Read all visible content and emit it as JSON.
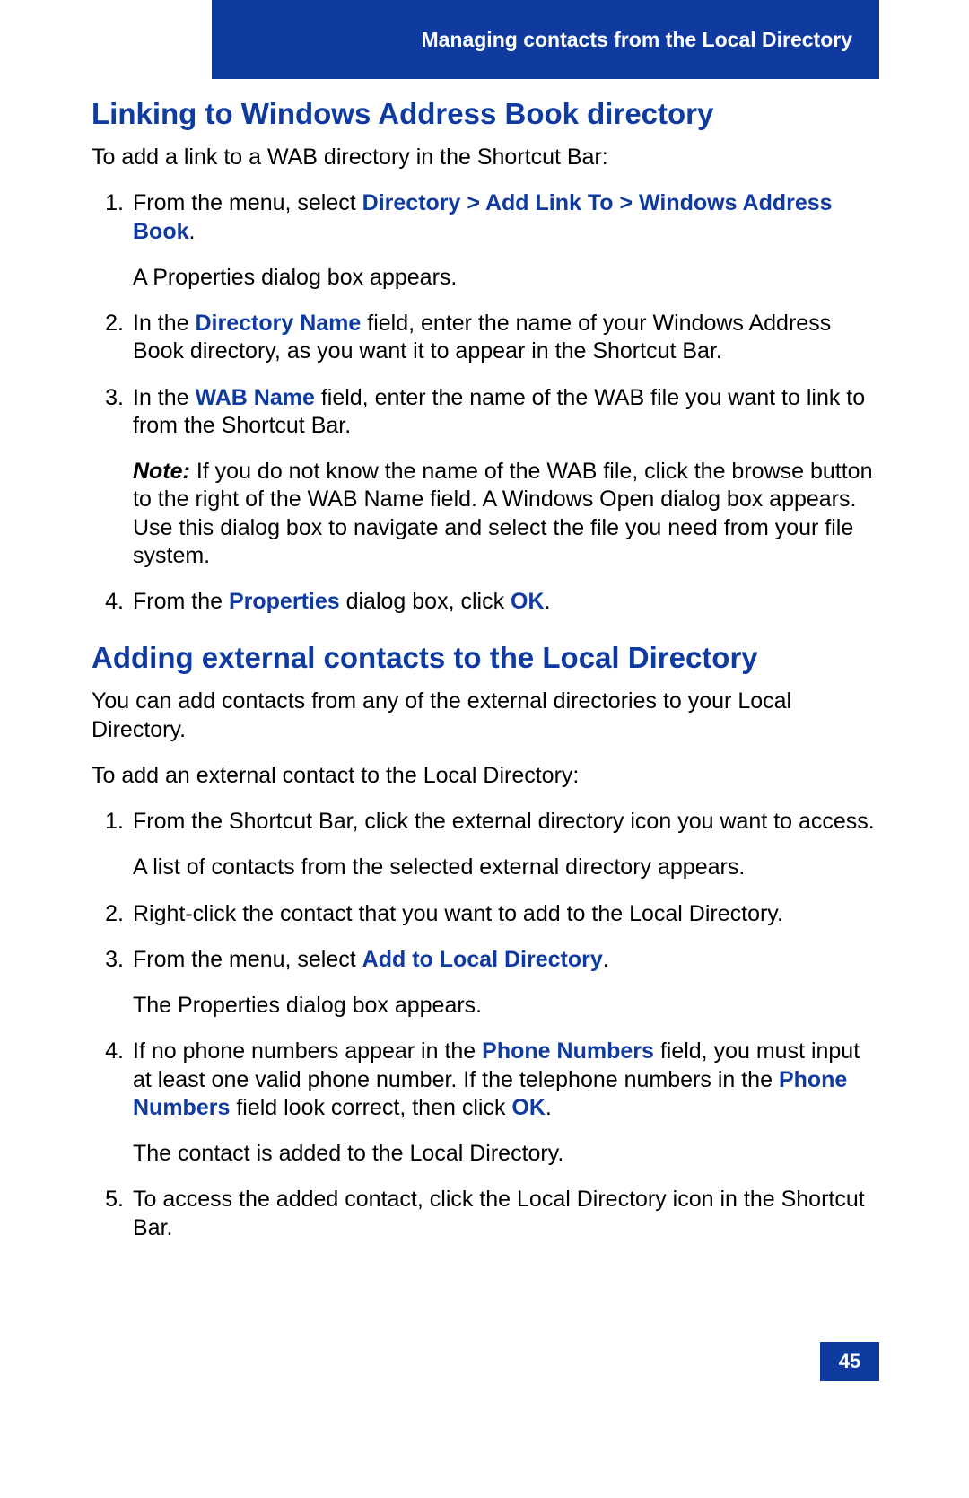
{
  "header": {
    "title": "Managing contacts from the Local Directory"
  },
  "section1": {
    "heading": "Linking to Windows Address Book directory",
    "intro": "To add a link to a WAB directory in the Shortcut Bar:",
    "steps": {
      "s1_a": "From the menu, select ",
      "s1_b": "Directory > Add Link To > Windows Address Book",
      "s1_c": ".",
      "s1_sub": "A Properties dialog box appears.",
      "s2_a": "In the ",
      "s2_b": "Directory Name",
      "s2_c": " field, enter the name of your Windows Address Book directory, as you want it to appear in the Shortcut Bar.",
      "s3_a": "In the ",
      "s3_b": "WAB Name",
      "s3_c": " field, enter the name of the WAB file you want to link to from the Shortcut Bar.",
      "s3_note_label": "Note:",
      "s3_note": " If you do not know the name of the WAB file, click the browse button to the right of the WAB Name field. A Windows Open dialog box appears. Use this dialog box to navigate and select the file you need from your file system.",
      "s4_a": "From the ",
      "s4_b": "Properties",
      "s4_c": " dialog box, click ",
      "s4_d": "OK",
      "s4_e": "."
    }
  },
  "section2": {
    "heading": "Adding external contacts to the Local Directory",
    "intro1": "You can add contacts from any of the external directories to your Local Directory.",
    "intro2": "To add an external contact to the Local Directory:",
    "steps": {
      "s1": "From the Shortcut Bar, click the external directory icon you want to access.",
      "s1_sub": "A list of contacts from the selected external directory appears.",
      "s2": "Right-click the contact that you want to add to the Local Directory.",
      "s3_a": "From the menu, select ",
      "s3_b": "Add to Local Directory",
      "s3_c": ".",
      "s3_sub": "The Properties dialog box appears.",
      "s4_a": "If no phone numbers appear in the ",
      "s4_b": "Phone Numbers",
      "s4_c": " field, you must input at least one valid phone number. If the telephone numbers in the ",
      "s4_d": "Phone Numbers",
      "s4_e": " field look correct, then click ",
      "s4_f": "OK",
      "s4_g": ".",
      "s4_sub": "The contact is added to the Local Directory.",
      "s5": "To access the added contact, click the Local Directory icon in the Shortcut Bar."
    }
  },
  "pageNumber": "45"
}
